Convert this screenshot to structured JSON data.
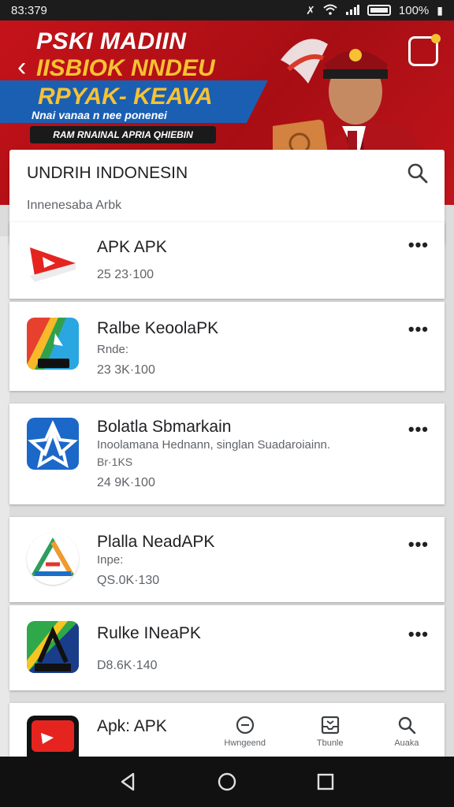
{
  "status_bar": {
    "time": "83:379",
    "battery_percent": "100%"
  },
  "banner": {
    "line1": "PSKI MADIIN",
    "line2": "IISBIOK NNDEU",
    "line3": "RPYAK- KEAVA",
    "line4": "Nnai vanaa n nee ponenei",
    "pill": "RAM RNAINAL APRIA QHIEBIN",
    "colors": {
      "red": "#c6121a",
      "yellow": "#f6c233",
      "blue": "#1b5fb3"
    }
  },
  "header": {
    "title": "UNDRIH INDONESIN",
    "subtitle": "Innenesaba Arbk",
    "search_icon": "search-icon"
  },
  "apps": [
    {
      "name": "APK APK",
      "meta": "25 23·100"
    },
    {
      "name": "Ralbe KeoolaPK",
      "desc": "Rnde:",
      "meta": "23 3K·100"
    },
    {
      "name": "Bolatla Sbmarkain",
      "desc": "Inoolamana Hednann, singlan Suadaroiainn.",
      "desc2": "Br·1KS",
      "meta": "24 9K·100"
    },
    {
      "name": "Plalla NeadAPK",
      "desc": "Inpe:",
      "meta": "QS.0K·130"
    },
    {
      "name": "Rulke INeaPK",
      "meta": "D8.6K·140"
    },
    {
      "name": "Apk: APK"
    }
  ],
  "bottom_nav": [
    {
      "label": "Hwngeend",
      "icon": "minus-circle-icon"
    },
    {
      "label": "Tbunle",
      "icon": "tray-icon"
    },
    {
      "label": "Auaka",
      "icon": "search-icon"
    }
  ],
  "more_label": "•••"
}
